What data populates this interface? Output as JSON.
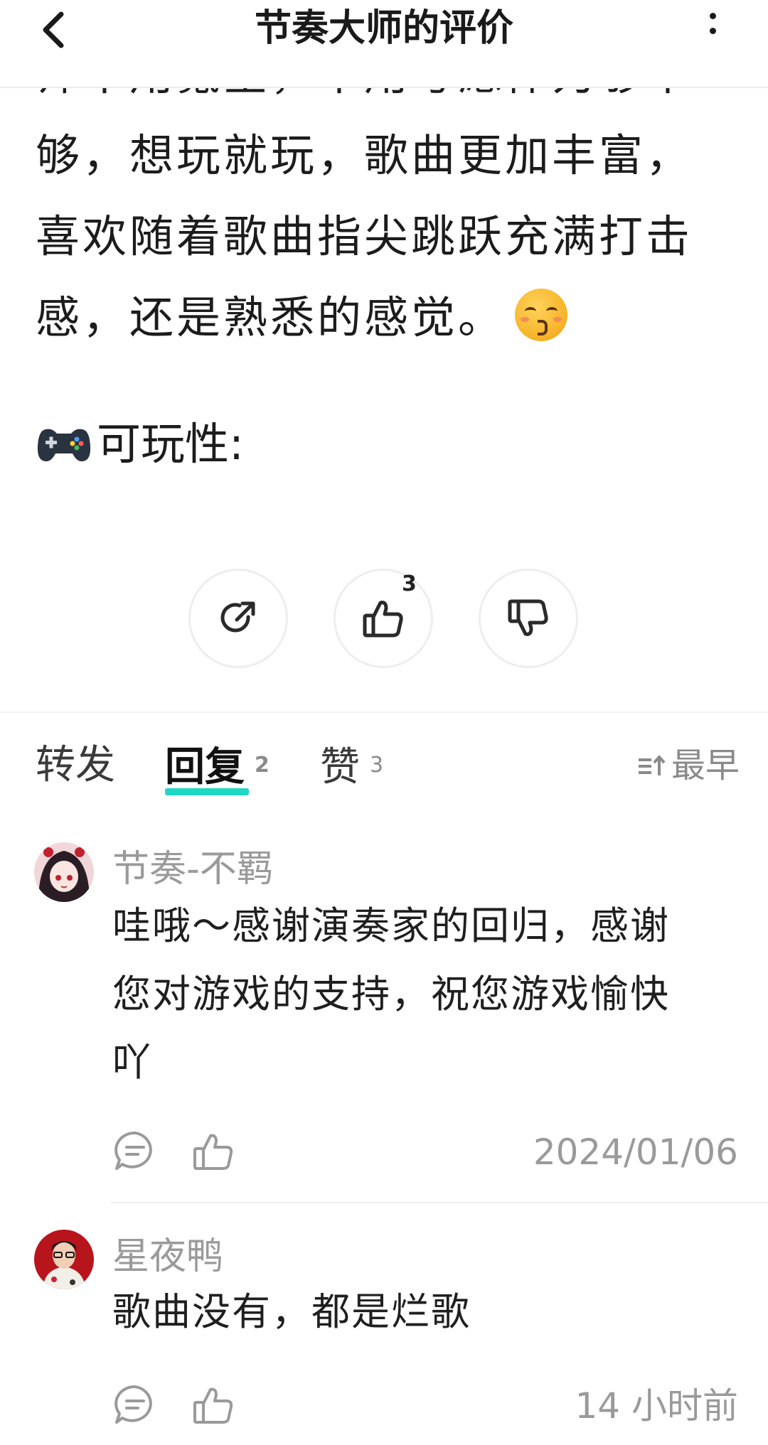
{
  "header": {
    "title": "节奏大师的评价"
  },
  "review": {
    "lines": [
      "师不用氪金，不用考虑体力够不",
      "够，想玩就玩，歌曲更加丰富，",
      "喜欢随着歌曲指尖跳跃充满打击",
      "感，还是熟悉的感觉。"
    ],
    "playability_label": "可玩性:",
    "like_count": "3"
  },
  "tabs": {
    "repost": "转发",
    "reply": "回复",
    "reply_count": "2",
    "likes": "赞",
    "likes_count": "3",
    "sort": "最早"
  },
  "comments": [
    {
      "name": "节奏-不羁",
      "text_lines": [
        "哇哦～感谢演奏家的回归，感谢",
        "您对游戏的支持，祝您游戏愉快",
        "吖"
      ],
      "date": "2024/01/06"
    },
    {
      "name": "星夜鸭",
      "text_lines": [
        "歌曲没有，都是烂歌"
      ],
      "date": "14 小时前"
    }
  ],
  "colors": {
    "accent": "#20d7c4",
    "muted": "#9a9a9a"
  },
  "icons": [
    "back-arrow-icon",
    "more-vertical-icon",
    "share-icon",
    "thumbs-up-icon",
    "thumbs-down-icon",
    "sort-icon",
    "comment-icon",
    "gamepad-icon",
    "kissing-face-icon"
  ]
}
